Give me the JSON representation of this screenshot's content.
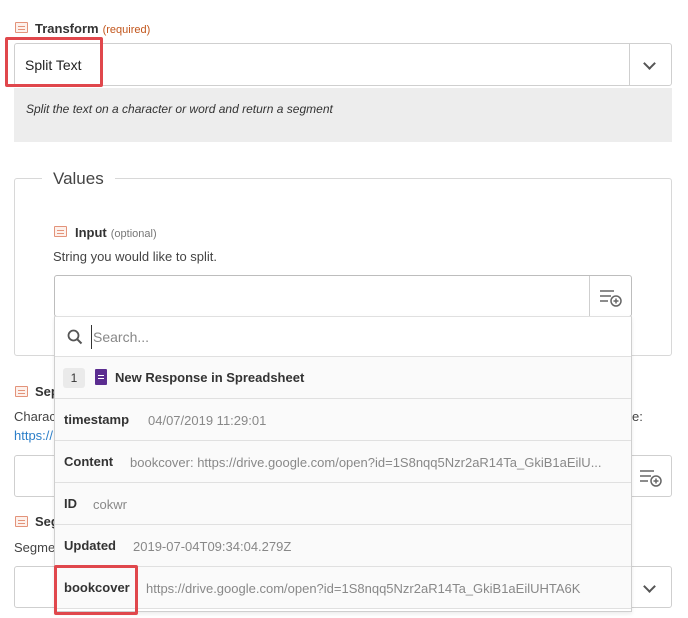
{
  "transform": {
    "label": "Transform",
    "required": "(required)",
    "value": "Split Text",
    "description": "Split the text on a character or word and return a segment"
  },
  "values": {
    "legend": "Values",
    "input_label": "Input",
    "input_optional": "(optional)",
    "input_help": "String you would like to split."
  },
  "separator": {
    "label": "Sep",
    "help": "Charac",
    "help_end": "e:",
    "link": "https://"
  },
  "segment": {
    "label": "Seg",
    "help": "Segme"
  },
  "dropdown": {
    "search_placeholder": "Search...",
    "step_number": "1",
    "step_title": "New Response in Spreadsheet",
    "options": [
      {
        "key": "timestamp",
        "value": "04/07/2019 11:29:01"
      },
      {
        "key": "Content",
        "value": "bookcover: https://drive.google.com/open?id=1S8nqq5Nzr2aR14Ta_GkiB1aEilU..."
      },
      {
        "key": "ID",
        "value": "cokwr"
      },
      {
        "key": "Updated",
        "value": "2019-07-04T09:34:04.279Z"
      },
      {
        "key": "bookcover",
        "value": "https://drive.google.com/open?id=1S8nqq5Nzr2aR14Ta_GkiB1aEilUHTA6K"
      }
    ]
  },
  "icons": {
    "field": "field-type-icon",
    "search": "search-icon",
    "insert": "insert-data-icon",
    "chevron": "chevron-down-icon",
    "app": "google-sheets-icon"
  },
  "colors": {
    "highlight": "#e0474c",
    "required": "#c2561c",
    "link": "#2c7fc9",
    "app_icon": "#5b2d90"
  }
}
